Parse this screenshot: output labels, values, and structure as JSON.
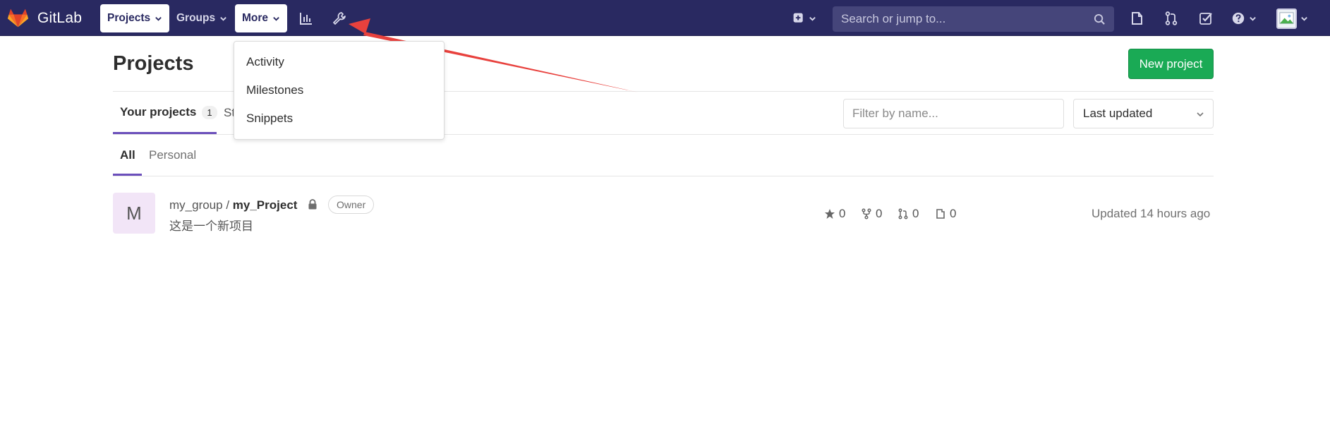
{
  "navbar": {
    "brand": "GitLab",
    "menus": [
      {
        "label": "Projects",
        "icon": "chevron-down-icon"
      },
      {
        "label": "Groups",
        "icon": "chevron-down-icon"
      },
      {
        "label": "More",
        "icon": "chevron-down-icon"
      }
    ],
    "icons": [
      "activity-chart-icon",
      "admin-wrench-icon",
      "plus-square-icon",
      "todo-icon",
      "merge-request-icon",
      "issues-check-icon",
      "help-icon",
      "avatar"
    ],
    "search_placeholder": "Search or jump to...",
    "colors": {
      "bar": "#292961",
      "search": "#45457a"
    }
  },
  "more_dropdown": {
    "items": [
      "Activity",
      "Milestones",
      "Snippets"
    ]
  },
  "main": {
    "title": "Projects",
    "new_project_label": "New project",
    "tabs": [
      {
        "label": "Your projects",
        "count": "1"
      },
      {
        "label": "St"
      }
    ],
    "filter_placeholder": "Filter by name...",
    "sort_label": "Last updated",
    "sub_tabs": [
      "All",
      "Personal"
    ],
    "projects": [
      {
        "avatar_letter": "M",
        "group": "my_group",
        "separator": " / ",
        "name": "my_Project",
        "role": "Owner",
        "description": "这是一个新项目",
        "stars": "0",
        "forks": "0",
        "merge_requests": "0",
        "issues": "0",
        "updated": "Updated 14 hours ago"
      }
    ]
  },
  "colors": {
    "accent_green": "#1aaa55",
    "tab_active": "#6b4fbb",
    "annotation_arrow": "#e8413d"
  }
}
